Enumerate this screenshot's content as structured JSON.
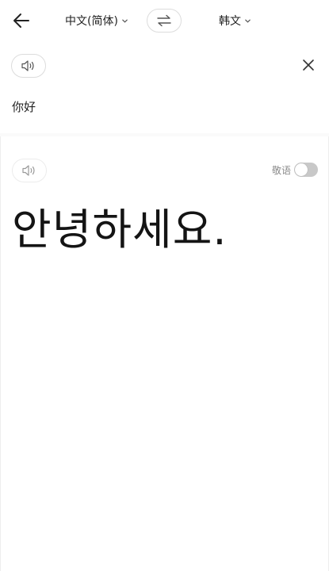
{
  "header": {
    "source_language": "中文(简体)",
    "target_language": "韩文"
  },
  "source": {
    "text": "你好"
  },
  "result": {
    "honorific_label": "敬语",
    "honorific_enabled": false,
    "translation": "안녕하세요."
  },
  "icons": {
    "back": "arrow-left-icon",
    "swap": "swap-icon",
    "speaker": "speaker-icon",
    "close": "close-icon",
    "chevron": "chevron-down-icon"
  }
}
